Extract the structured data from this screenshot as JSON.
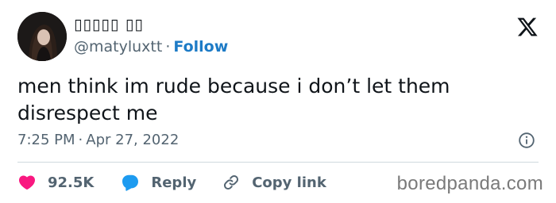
{
  "author": {
    "display_name": "▯▯▯▯▯ ▯▯",
    "handle": "@matyluxtt",
    "separator": "·",
    "follow_label": "Follow"
  },
  "tweet": {
    "text": "men think im rude because i don’t let them disrespect me",
    "time": "7:25 PM",
    "separator": "·",
    "date": "Apr 27, 2022"
  },
  "actions": {
    "like_count": "92.5K",
    "reply_label": "Reply",
    "copy_link_label": "Copy link"
  },
  "watermark": "boredpanda.com",
  "colors": {
    "follow": "#1d7bc6",
    "like": "#f91880",
    "reply": "#1d9bf0",
    "secondary_text": "#536471"
  },
  "icons": {
    "platform": "x-logo-icon",
    "info": "info-icon",
    "like": "heart-icon",
    "reply": "speech-bubble-icon",
    "copy_link": "link-icon"
  }
}
